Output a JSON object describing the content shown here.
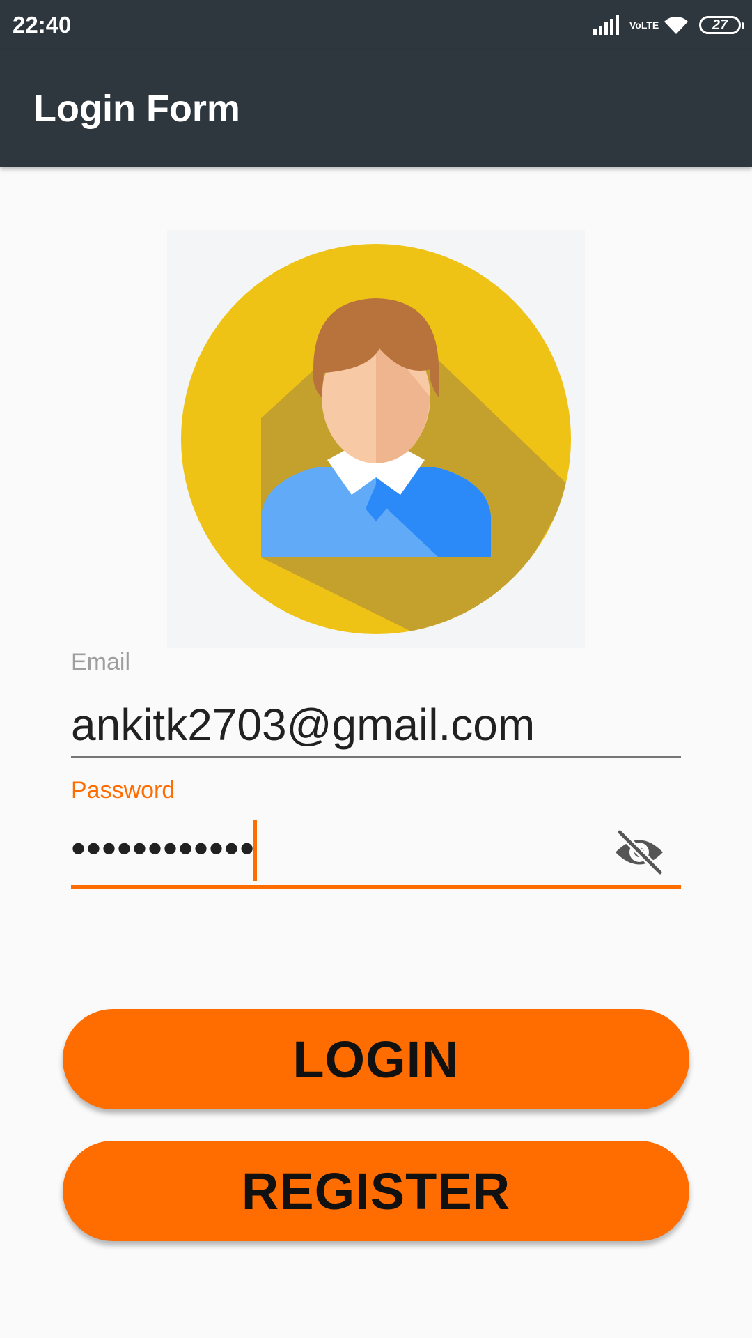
{
  "status_bar": {
    "time": "22:40",
    "network": "VoLTE",
    "battery": "27",
    "icons": [
      "signal-icon",
      "volte-icon",
      "wifi-icon",
      "battery-icon"
    ]
  },
  "app_bar": {
    "title": "Login Form"
  },
  "avatar": {
    "icon": "user-avatar-icon",
    "background_color": "#f0c419"
  },
  "form": {
    "email_label": "Email",
    "email_value": "ankitk2703@gmail.com",
    "password_label": "Password",
    "password_value": "••••••••••••",
    "password_toggle_icon": "eye-off-icon"
  },
  "buttons": {
    "login_label": "LOGIN",
    "register_label": "REGISTER"
  },
  "colors": {
    "app_bar": "#2f373e",
    "accent": "#ff6d00",
    "background": "#fafafa"
  }
}
